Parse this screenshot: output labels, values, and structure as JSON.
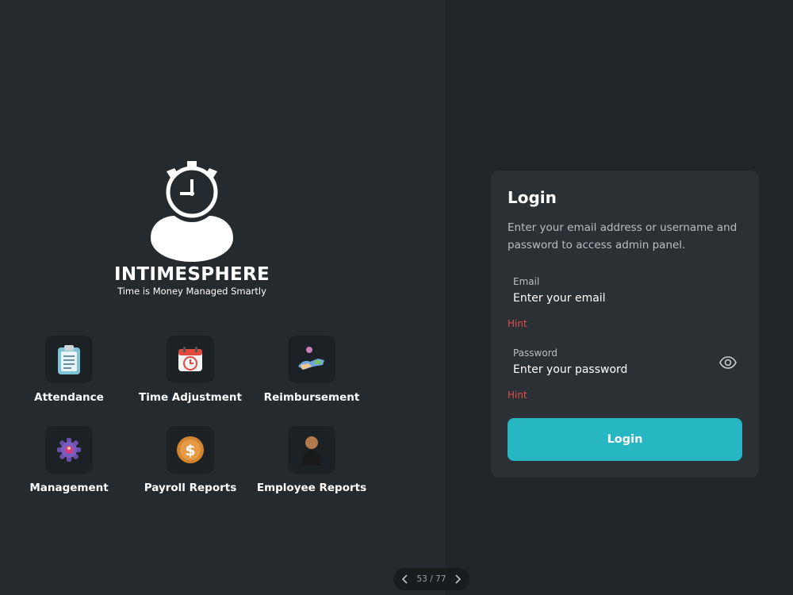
{
  "brand": {
    "name": "INTIMESPHERE",
    "tagline": "Time is Money Managed Smartly"
  },
  "features": [
    {
      "label": "Attendance",
      "icon": "clipboard-icon"
    },
    {
      "label": "Time Adjustment",
      "icon": "calendar-clock-icon"
    },
    {
      "label": "Reimbursement",
      "icon": "hand-money-icon"
    },
    {
      "label": "Management",
      "icon": "gear-icon"
    },
    {
      "label": "Payroll Reports",
      "icon": "dollar-coin-icon"
    },
    {
      "label": "Employee Reports",
      "icon": "person-icon"
    }
  ],
  "login": {
    "title": "Login",
    "description": "Enter your email address or username and password to access admin panel.",
    "email_label": "Email",
    "email_placeholder": "Enter your email",
    "email_hint": "Hint",
    "password_label": "Password",
    "password_placeholder": "Enter your password",
    "password_hint": "Hint",
    "button_label": "Login"
  },
  "pager": {
    "text": "53 / 77"
  },
  "colors": {
    "accent": "#27b7c3",
    "hint": "#e0504f",
    "card": "#2a3034"
  }
}
